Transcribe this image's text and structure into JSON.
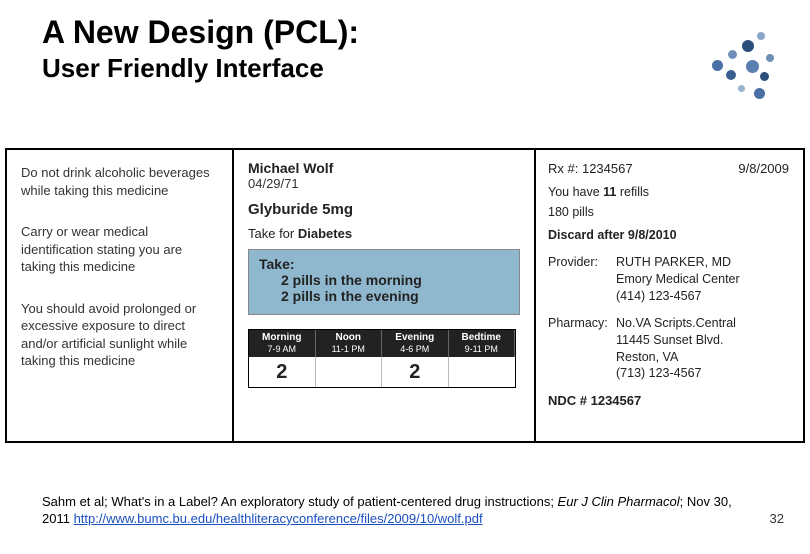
{
  "title": "A New Design (PCL):",
  "subtitle": "User Friendly Interface",
  "warnings": [
    "Do not drink alcoholic beverages while taking this medicine",
    "Carry or wear medical identification stating you are taking this medicine",
    "You should avoid prolonged or excessive exposure to direct and/or artificial sunlight while taking this medicine"
  ],
  "patient": {
    "name": "Michael Wolf",
    "dob": "04/29/71"
  },
  "drug": "Glyburide 5mg",
  "condition_prefix": "Take for ",
  "condition": "Diabetes",
  "dosage": {
    "header": "Take:",
    "line1": "2 pills in the morning",
    "line2": "2 pills in the evening"
  },
  "schedule": {
    "cols": [
      {
        "label": "Morning",
        "time": "7-9 AM",
        "val": "2"
      },
      {
        "label": "Noon",
        "time": "11-1 PM",
        "val": ""
      },
      {
        "label": "Evening",
        "time": "4-6 PM",
        "val": "2"
      },
      {
        "label": "Bedtime",
        "time": "9-11 PM",
        "val": ""
      }
    ]
  },
  "rx": {
    "number_label": "Rx #: ",
    "number": "1234567",
    "date": "9/8/2009",
    "refills_pre": "You have ",
    "refills_n": "11",
    "refills_post": " refills",
    "pills": "180 pills",
    "discard": "Discard after 9/8/2010",
    "provider_label": "Provider:",
    "provider": "RUTH PARKER, MD\nEmory Medical Center\n(414) 123-4567",
    "pharmacy_label": "Pharmacy:",
    "pharmacy": "No.VA Scripts.Central\n11445 Sunset Blvd.\nReston, VA\n(713) 123-4567",
    "ndc": "NDC # 1234567"
  },
  "citation": {
    "text1": "Sahm et al; What's in a Label? An exploratory study of patient-centered drug instructions; ",
    "journal": "Eur J Clin Pharmacol",
    "text2": "; Nov 30, 2011    ",
    "link": "http://www.bumc.bu.edu/healthliteracyconference/files/2009/10/wolf.pdf"
  },
  "page_number": "32"
}
